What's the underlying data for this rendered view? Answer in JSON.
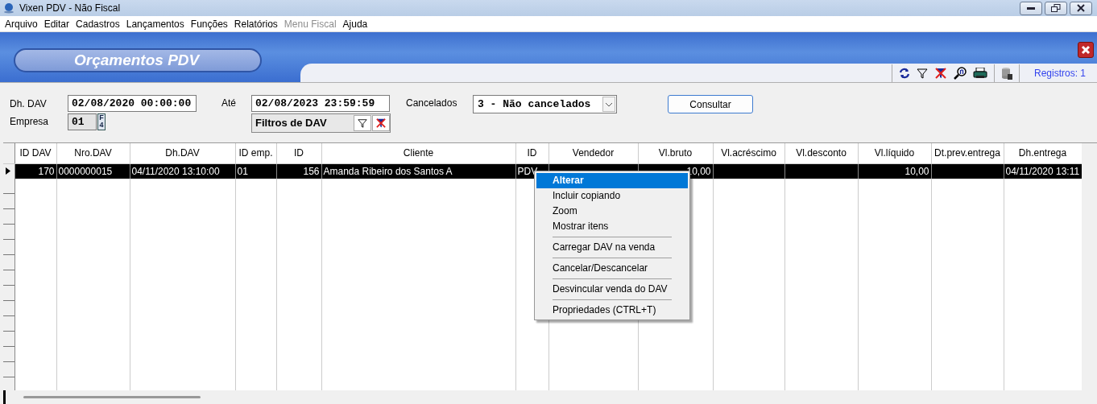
{
  "window": {
    "title": "Vixen PDV - Não Fiscal"
  },
  "menu_bar": [
    {
      "label": "Arquivo",
      "disabled": false
    },
    {
      "label": "Editar",
      "disabled": false
    },
    {
      "label": "Cadastros",
      "disabled": false
    },
    {
      "label": "Lançamentos",
      "disabled": false
    },
    {
      "label": "Funções",
      "disabled": false
    },
    {
      "label": "Relatórios",
      "disabled": false
    },
    {
      "label": "Menu Fiscal",
      "disabled": true
    },
    {
      "label": "Ajuda",
      "disabled": false
    }
  ],
  "banner": {
    "title": "Orçamentos PDV"
  },
  "toolbar": {
    "records": "Registros: 1"
  },
  "filters": {
    "dh_dav": {
      "label": "Dh. DAV",
      "value": "02/08/2020 00:00:00"
    },
    "empresa": {
      "label": "Empresa",
      "value": "01",
      "key_button": "F4"
    },
    "ate": {
      "label": "Até",
      "value": "02/08/2023 23:59:59"
    },
    "dav_filters": {
      "label": "Filtros de DAV"
    },
    "cancelados": {
      "label": "Cancelados",
      "value": "3 - Não cancelados"
    },
    "consultar": {
      "label": "Consultar"
    }
  },
  "table": {
    "columns": [
      "ID DAV",
      "Nro.DAV",
      "Dh.DAV",
      "ID emp.",
      "ID",
      "Cliente",
      "ID",
      "Vendedor",
      "Vl.bruto",
      "Vl.acréscimo",
      "Vl.desconto",
      "Vl.líquido",
      "Dt.prev.entrega",
      "Dh.entrega"
    ],
    "rows": [
      {
        "selected": true,
        "cells": [
          "170",
          "0000000015",
          "04/11/2020 13:10:00",
          "01",
          "156",
          "Amanda Ribeiro dos Santos A",
          "PDV",
          null,
          "10,00",
          null,
          null,
          "10,00",
          null,
          "04/11/2020 13:11"
        ]
      }
    ]
  },
  "context_menu": {
    "items": [
      {
        "kind": "item",
        "label": "Alterar",
        "selected": true
      },
      {
        "kind": "item",
        "label": "Incluir copiando",
        "selected": false
      },
      {
        "kind": "item",
        "label": "Zoom",
        "selected": false
      },
      {
        "kind": "item",
        "label": "Mostrar itens",
        "selected": false
      },
      {
        "kind": "separator"
      },
      {
        "kind": "item",
        "label": "Carregar DAV na venda",
        "selected": false
      },
      {
        "kind": "separator"
      },
      {
        "kind": "item",
        "label": "Cancelar/Descancelar",
        "selected": false
      },
      {
        "kind": "separator"
      },
      {
        "kind": "item",
        "label": "Desvincular venda do DAV",
        "selected": false
      },
      {
        "kind": "separator"
      },
      {
        "kind": "item",
        "label": "Propriedades (CTRL+T)",
        "selected": false
      }
    ]
  }
}
